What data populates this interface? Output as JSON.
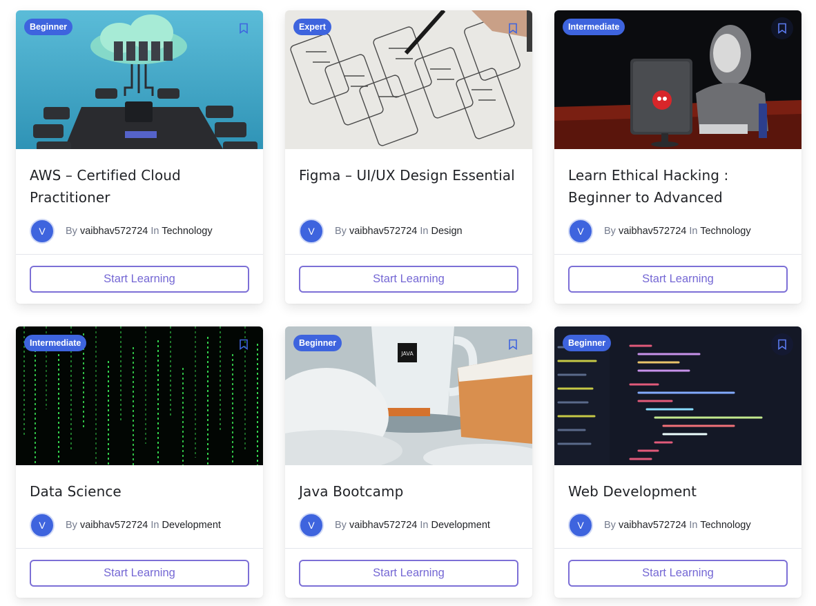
{
  "courses": [
    {
      "level": "Beginner",
      "title": "AWS – Certified Cloud Practitioner",
      "avatar_initial": "V",
      "by_label": "By",
      "author": "vaibhav572724",
      "in_label": "In",
      "category": "Technology",
      "button_label": "Start Learning"
    },
    {
      "level": "Expert",
      "title": "Figma – UI/UX Design Essential",
      "avatar_initial": "V",
      "by_label": "By",
      "author": "vaibhav572724",
      "in_label": "In",
      "category": "Design",
      "button_label": "Start Learning"
    },
    {
      "level": "Intermediate",
      "title": "Learn Ethical Hacking : Beginner to Advanced",
      "avatar_initial": "V",
      "by_label": "By",
      "author": "vaibhav572724",
      "in_label": "In",
      "category": "Technology",
      "button_label": "Start Learning"
    },
    {
      "level": "Intermediate",
      "title": "Data Science",
      "avatar_initial": "V",
      "by_label": "By",
      "author": "vaibhav572724",
      "in_label": "In",
      "category": "Development",
      "button_label": "Start Learning"
    },
    {
      "level": "Beginner",
      "title": "Java Bootcamp",
      "avatar_initial": "V",
      "by_label": "By",
      "author": "vaibhav572724",
      "in_label": "In",
      "category": "Development",
      "button_label": "Start Learning"
    },
    {
      "level": "Beginner",
      "title": "Web Development",
      "avatar_initial": "V",
      "by_label": "By",
      "author": "vaibhav572724",
      "in_label": "In",
      "category": "Technology",
      "button_label": "Start Learning"
    }
  ],
  "thumb_art": [
    "cloud-servers-image",
    "wireframe-sketch-image",
    "hacker-computer-image",
    "matrix-code-image",
    "java-coffee-image",
    "code-editor-image"
  ],
  "mug_text": "JAVA",
  "icons": {
    "bookmark": "bookmark-icon"
  },
  "colors": {
    "accent": "#3e64de",
    "button": "#7467d4"
  }
}
